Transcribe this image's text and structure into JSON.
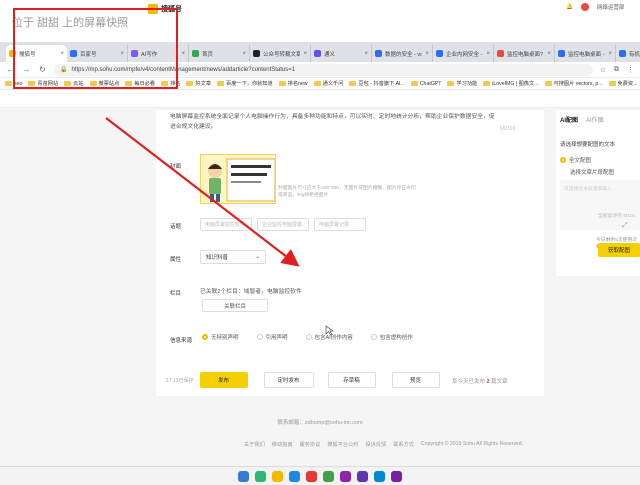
{
  "window": {
    "snapshot_title": "位于 甜甜 上的屏幕快照"
  },
  "tabs": [
    {
      "label": "搜狐号",
      "color": "#f5b800"
    },
    {
      "label": "百家号",
      "color": "#2d6cf6"
    },
    {
      "label": "AI写作",
      "color": "#7a5cf0"
    },
    {
      "label": "首页",
      "color": "#34a853"
    },
    {
      "label": "公众号转载文章",
      "color": "#222222"
    },
    {
      "label": "通义",
      "color": "#6b4cf0"
    },
    {
      "label": "数据的安全 - vol",
      "color": "#2d6cf6"
    },
    {
      "label": "企业内网安全 - g",
      "color": "#2d6cf6"
    },
    {
      "label": "监控电脑桌面?",
      "color": "#e84c3d"
    },
    {
      "label": "监控电脑桌面 - 目",
      "color": "#2d6cf6"
    },
    {
      "label": "有机体有做吗",
      "color": "#2d6cf6"
    }
  ],
  "address": {
    "url": "https://mp.sohu.com/mpfe/v4/contentManagement/news/addarticle?contentStatus=1"
  },
  "bookmarks": [
    "seo",
    "青苗网站",
    "云站",
    "微票站点",
    "每日必看",
    "排名",
    "好文章",
    "百度一下，你就知道",
    "排名new",
    "通义千问",
    "豆包 - 抖音旗下 AI...",
    "ChatGPT",
    "学习功能",
    "iLoveIMG | 图像文...",
    "可搜图片 vectors, p...",
    "免费资..."
  ],
  "site": {
    "logo": "搜狐号",
    "notice_icon": "bell-icon",
    "user_label": "网络运营部"
  },
  "form": {
    "summary": "电脑屏幕监控系统全面记录个人电脑操作行为，具备多种功能和特点，可以实时、定时地统计分析，帮助企业保护数据安全，促进合规文化建设。",
    "summary_count": "65/120",
    "cover_label": "封面",
    "cover_tips": "封面图片尺寸应大于400*300，无图片或图片模糊、图片存在水印或商品，Rig将拒绝图片",
    "tag_label": "话题",
    "tags": [
      "电脑屏幕监控软件",
      "企业监控电脑屏幕",
      "电脑屏幕记录"
    ],
    "attr_label": "属性",
    "attr_value": "知识科普",
    "column_label": "栏目",
    "column_text": "已关联2个栏目：域智者，电脑监控软件",
    "column_button": "关联栏目",
    "source_label": "信息来源",
    "sources": [
      {
        "label": "无特别声明",
        "checked": true
      },
      {
        "label": "引用声明",
        "checked": false
      },
      {
        "label": "包含AI创作内容",
        "checked": false
      },
      {
        "label": "包含虚构创作",
        "checked": false
      }
    ],
    "autosave": "17:13已保存",
    "publish": "发布",
    "schedule": "定时发布",
    "save_draft": "存草稿",
    "preview": "预览",
    "draft_prefix": "草今天已发布",
    "draft_count": "2",
    "draft_suffix": "篇文章"
  },
  "footer": {
    "email": "联系邮箱：zdhomp@sohu-inc.com",
    "links": [
      "关于我们",
      "移动指南",
      "服务协议",
      "搜狐平台公约",
      "投诉反馈",
      "联系方式"
    ],
    "copyright": "Copyright © 2019 Sohu All Rights Reserved."
  },
  "sidepanel": {
    "tab_active": "AI配图",
    "tab_other": "AI作图",
    "desc": "请选择想要配图的文本",
    "option1": "全文配图",
    "option2": "选择文章片段配图",
    "placeholder": "可选择文本段落或输入",
    "count": "全部复述完 5/100",
    "quota": "今日剩余5次使用次数",
    "button": "获取配图"
  },
  "taskbar_colors": [
    "#3a7bd5",
    "#2bb673",
    "#f5b800",
    "#1e88e5",
    "#e53935",
    "#43a047",
    "#8e24aa",
    "#5e35b1",
    "#0288d1",
    "#7b1fa2"
  ]
}
